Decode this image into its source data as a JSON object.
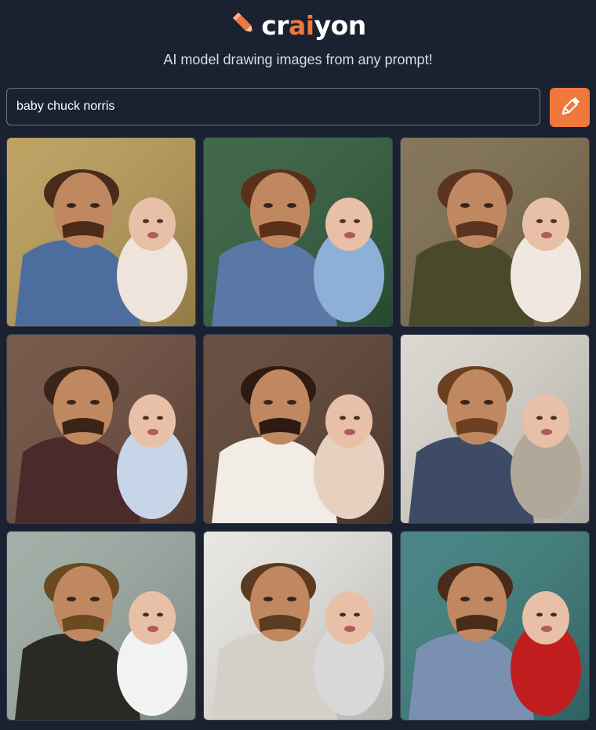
{
  "header": {
    "logo_parts": {
      "pre": "cr",
      "accent": "ai",
      "post": "yon"
    },
    "logo_icon": "pencil-icon",
    "tagline": "AI model drawing images from any prompt!"
  },
  "search": {
    "value": "baby chuck norris",
    "button_icon": "pencil-icon"
  },
  "colors": {
    "background": "#1a2130",
    "accent": "#f0783c"
  },
  "results": [
    {
      "bg": "#b89a56",
      "shirt": "#4d6d9e",
      "baby": "#efe4dc",
      "hair": "#4a2a18"
    },
    {
      "bg": "#2f5a3a",
      "shirt": "#5a78a6",
      "baby": "#8fb0d6",
      "hair": "#5a3018"
    },
    {
      "bg": "#7a6a4a",
      "shirt": "#4a4a2a",
      "baby": "#f0e8e0",
      "hair": "#5a3420"
    },
    {
      "bg": "#6a4a3a",
      "shirt": "#4a2a2a",
      "baby": "#c8d4e8",
      "hair": "#3a2418"
    },
    {
      "bg": "#5a4030",
      "shirt": "#f2ece6",
      "baby": "#e6d0c0",
      "hair": "#2e1a10"
    },
    {
      "bg": "#d8d4cc",
      "shirt": "#3e4a66",
      "baby": "#b0a898",
      "hair": "#6a4020"
    },
    {
      "bg": "#9aa8a0",
      "shirt": "#2a2a24",
      "baby": "#f2f2f2",
      "hair": "#6a4a20"
    },
    {
      "bg": "#e6e4e0",
      "shirt": "#d4d0c8",
      "baby": "#d8d8d8",
      "hair": "#5a3a20"
    },
    {
      "bg": "#3a7a7a",
      "shirt": "#7a90b0",
      "baby": "#c01e1e",
      "hair": "#4a2a18"
    }
  ]
}
